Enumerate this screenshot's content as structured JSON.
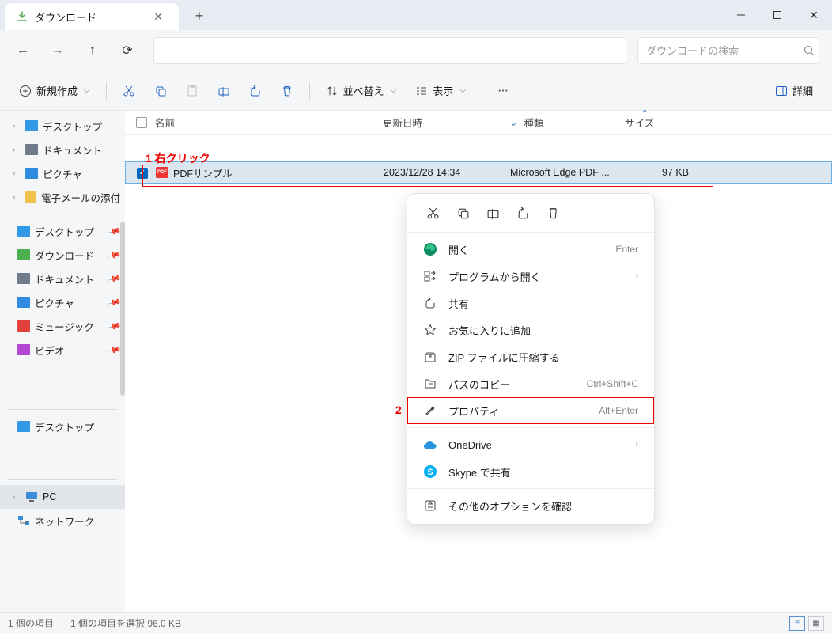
{
  "titlebar": {
    "tab_title": "ダウンロード"
  },
  "navbar": {
    "search_placeholder": "ダウンロードの検索"
  },
  "toolbar": {
    "new_label": "新規作成",
    "sort_label": "並べ替え",
    "view_label": "表示",
    "details_label": "詳細"
  },
  "columns": {
    "name": "名前",
    "date": "更新日時",
    "type": "種類",
    "size": "サイズ"
  },
  "sidebar": {
    "nav": [
      {
        "label": "デスクトップ",
        "icon": "desktop",
        "color": "#3299e8"
      },
      {
        "label": "ドキュメント",
        "icon": "document",
        "color": "#6f7b8a"
      },
      {
        "label": "ピクチャ",
        "icon": "pictures",
        "color": "#2e8be0"
      },
      {
        "label": "電子メールの添付",
        "icon": "folder",
        "color": "#f0c14b"
      }
    ],
    "quick": [
      {
        "label": "デスクトップ",
        "color": "#3299e8"
      },
      {
        "label": "ダウンロード",
        "color": "#4caf50"
      },
      {
        "label": "ドキュメント",
        "color": "#6f7b8a"
      },
      {
        "label": "ピクチャ",
        "color": "#2e8be0"
      },
      {
        "label": "ミュージック",
        "color": "#e2403a"
      },
      {
        "label": "ビデオ",
        "color": "#b048d4"
      }
    ],
    "lower_nav": {
      "label": "デスクトップ",
      "color": "#3299e8"
    },
    "pc": {
      "label": "PC"
    },
    "network": {
      "label": "ネットワーク"
    }
  },
  "files": [
    {
      "name": "PDFサンプル",
      "date": "2023/12/28 14:34",
      "type": "Microsoft Edge PDF ...",
      "size": "97 KB"
    }
  ],
  "annotations": {
    "one": "1 右クリック",
    "two": "2"
  },
  "context_menu": {
    "open": {
      "label": "開く",
      "shortcut": "Enter"
    },
    "open_with": {
      "label": "プログラムから開く"
    },
    "share": {
      "label": "共有"
    },
    "favorite": {
      "label": "お気に入りに追加"
    },
    "zip": {
      "label": "ZIP ファイルに圧縮する"
    },
    "copy_path": {
      "label": "パスのコピー",
      "shortcut": "Ctrl+Shift+C"
    },
    "properties": {
      "label": "プロパティ",
      "shortcut": "Alt+Enter"
    },
    "onedrive": {
      "label": "OneDrive"
    },
    "skype": {
      "label": "Skype で共有"
    },
    "more": {
      "label": "その他のオプションを確認"
    }
  },
  "statusbar": {
    "item_count": "1 個の項目",
    "selected": "1 個の項目を選択 96.0 KB"
  }
}
